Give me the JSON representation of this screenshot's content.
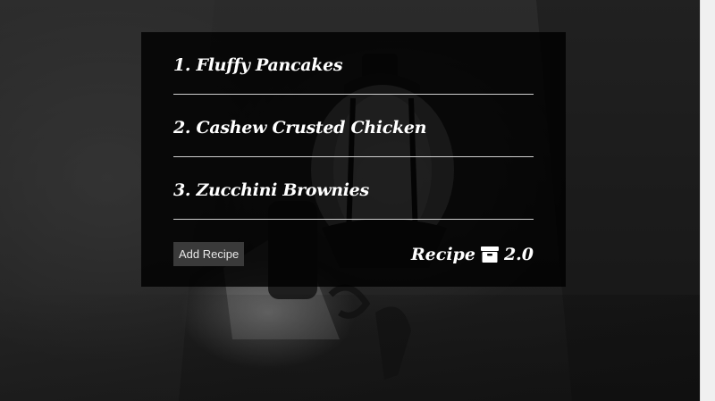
{
  "recipes": [
    {
      "label": "1. Fluffy Pancakes"
    },
    {
      "label": "2. Cashew Crusted Chicken"
    },
    {
      "label": "3. Zucchini Brownies"
    }
  ],
  "footer": {
    "add_button_label": "Add Recipe",
    "brand_name": "Recipe",
    "brand_icon": "archive-box-icon",
    "brand_version": "2.0"
  },
  "colors": {
    "panel_background": "#000000",
    "text": "#ffffff",
    "button_background": "#3a3a3a",
    "divider": "#cfcfcf"
  }
}
